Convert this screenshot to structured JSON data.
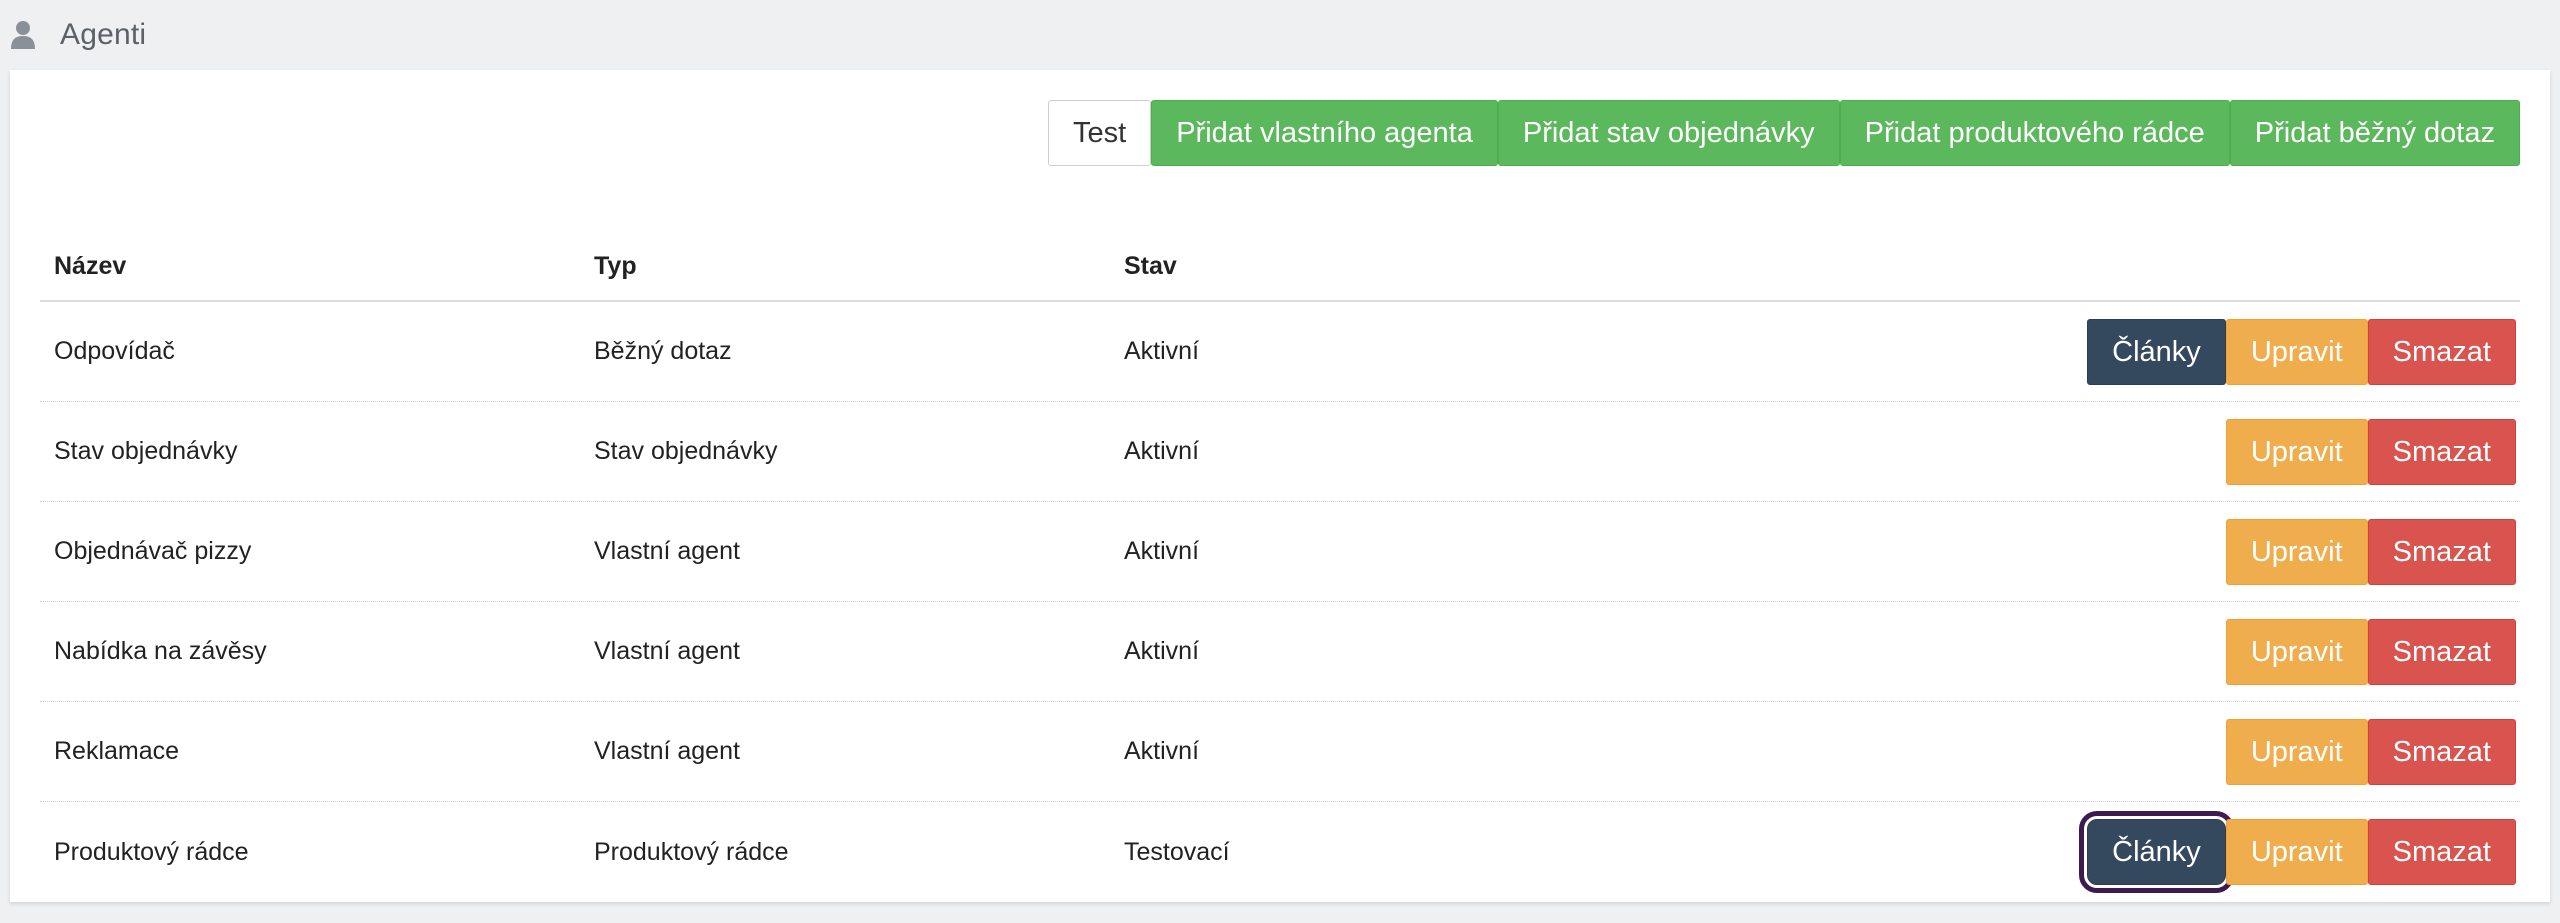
{
  "header": {
    "title": "Agenti",
    "icon": "user-icon"
  },
  "toolbar": {
    "test_label": "Test",
    "add_custom_label": "Přidat vlastního agenta",
    "add_order_state_label": "Přidat stav objednávky",
    "add_product_advisor_label": "Přidat produktového rádce",
    "add_common_query_label": "Přidat běžný dotaz"
  },
  "table": {
    "headers": {
      "name": "Název",
      "type": "Typ",
      "state": "Stav"
    },
    "rows": [
      {
        "name": "Odpovídač",
        "type": "Běžný dotaz",
        "state": "Aktivní"
      },
      {
        "name": "Stav objednávky",
        "type": "Stav objednávky",
        "state": "Aktivní"
      },
      {
        "name": "Objednávač pizzy",
        "type": "Vlastní agent",
        "state": "Aktivní"
      },
      {
        "name": "Nabídka na závěsy",
        "type": "Vlastní agent",
        "state": "Aktivní"
      },
      {
        "name": "Reklamace",
        "type": "Vlastní agent",
        "state": "Aktivní"
      },
      {
        "name": "Produktový rádce",
        "type": "Produktový rádce",
        "state": "Testovací"
      }
    ],
    "actions": {
      "articles": "Články",
      "edit": "Upravit",
      "delete": "Smazat"
    }
  },
  "colors": {
    "green": "#5cb85c",
    "dark": "#34495e",
    "orange": "#f0ad4e",
    "red": "#d9534f",
    "focus": "#3d1a4f"
  }
}
